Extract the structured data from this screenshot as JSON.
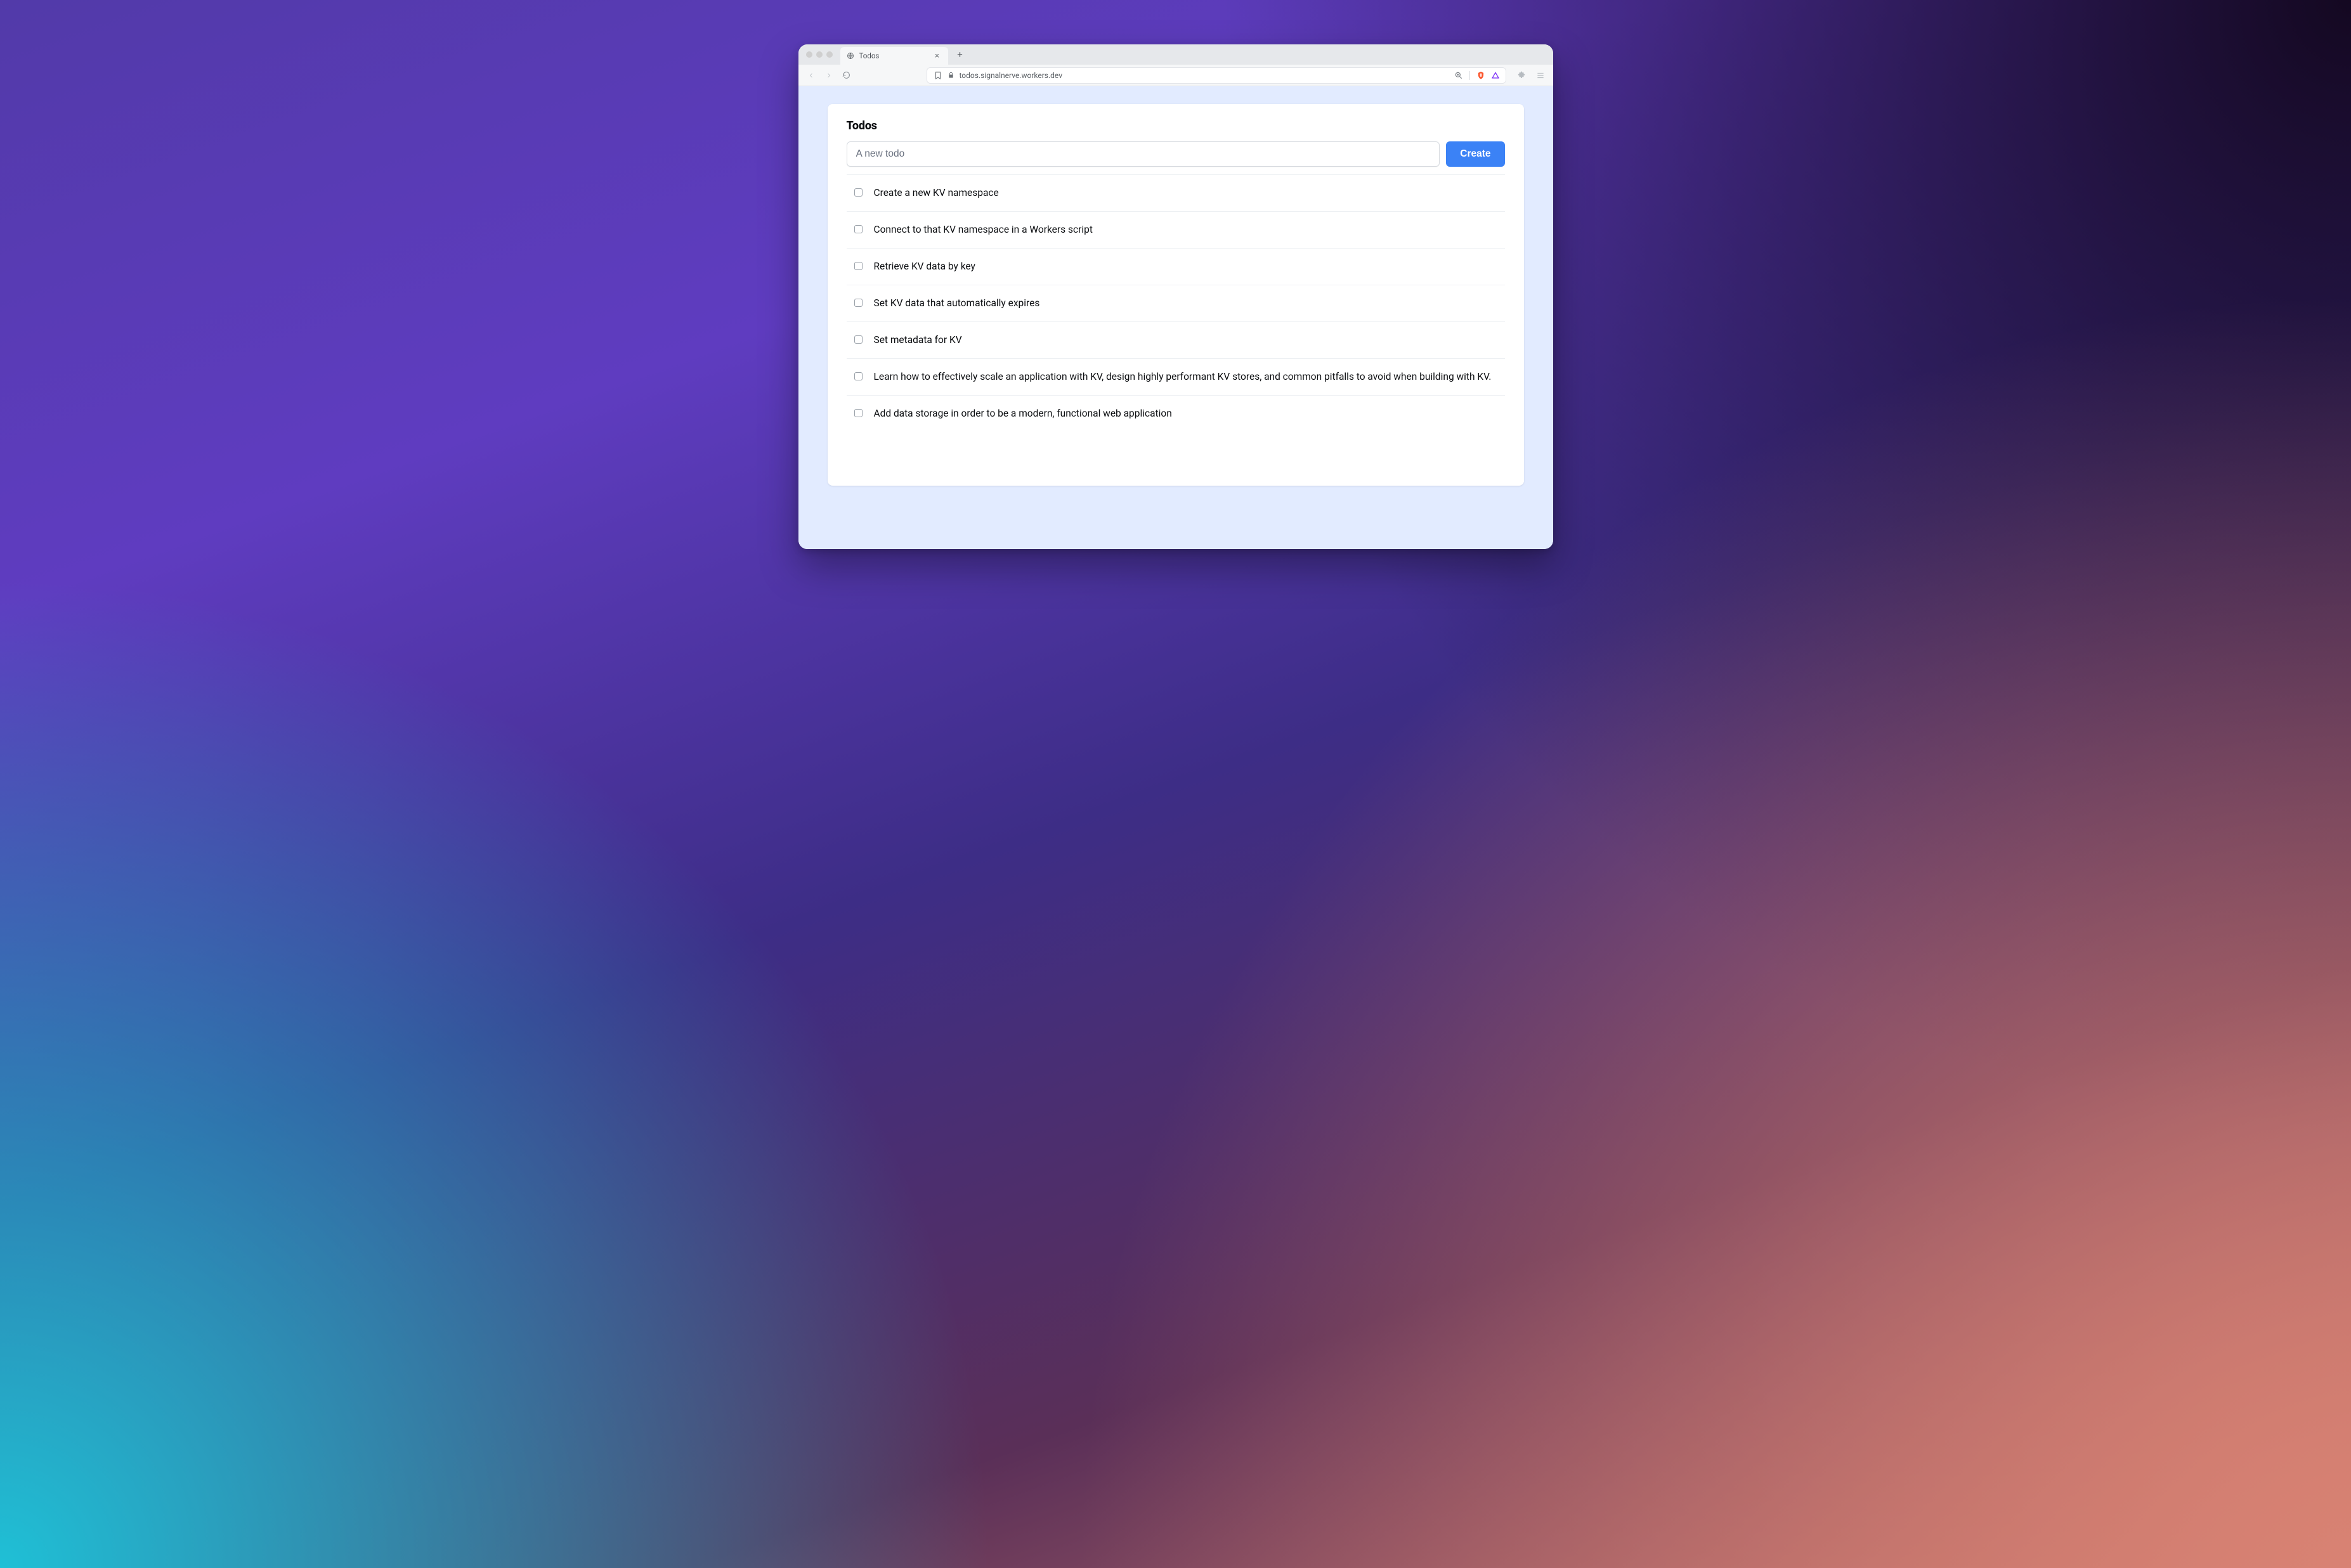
{
  "browser": {
    "tab_title": "Todos",
    "url": "todos.signalnerve.workers.dev"
  },
  "page": {
    "heading": "Todos",
    "input_placeholder": "A new todo",
    "create_button": "Create",
    "todos": [
      {
        "label": "Create a new KV namespace",
        "done": false
      },
      {
        "label": "Connect to that KV namespace in a Workers script",
        "done": false
      },
      {
        "label": "Retrieve KV data by key",
        "done": false
      },
      {
        "label": "Set KV data that automatically expires",
        "done": false
      },
      {
        "label": "Set metadata for KV",
        "done": false
      },
      {
        "label": "Learn how to effectively scale an application with KV, design highly performant KV stores, and common pitfalls to avoid when building with KV.",
        "done": false
      },
      {
        "label": "Add data storage in order to be a modern, functional web application",
        "done": false
      }
    ]
  }
}
